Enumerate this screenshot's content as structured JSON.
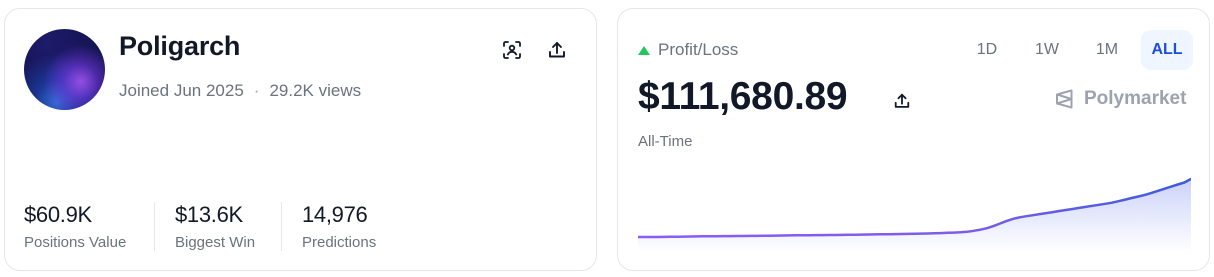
{
  "profile": {
    "username": "Poligarch",
    "joined": "Joined Jun 2025",
    "separator": "·",
    "views": "29.2K views",
    "stats": [
      {
        "value": "$60.9K",
        "label": "Positions Value"
      },
      {
        "value": "$13.6K",
        "label": "Biggest Win"
      },
      {
        "value": "14,976",
        "label": "Predictions"
      }
    ],
    "icons": {
      "scan": "scan-qr-icon",
      "share": "share-upload-icon"
    }
  },
  "pnl": {
    "label": "Profit/Loss",
    "value": "$111,680.89",
    "period": "All-Time",
    "brand": "Polymarket",
    "tabs": [
      {
        "label": "1D",
        "active": false
      },
      {
        "label": "1W",
        "active": false
      },
      {
        "label": "1M",
        "active": false
      },
      {
        "label": "ALL",
        "active": true
      }
    ],
    "colors": {
      "positive": "#22c55e",
      "line_start": "#8b5cf6",
      "line_end": "#3b5bdb"
    }
  },
  "chart_data": {
    "type": "area",
    "title": "",
    "xlabel": "",
    "ylabel": "",
    "grid": false,
    "y": [
      0,
      0,
      0,
      0,
      200,
      400,
      600,
      800,
      1000,
      1200,
      1400,
      1500,
      1600,
      1700,
      1800,
      1900,
      2000,
      2100,
      2200,
      2300,
      2400,
      2600,
      2800,
      3000,
      3200,
      3400,
      3500,
      3600,
      3700,
      3800,
      3900,
      4000,
      4200,
      4400,
      4600,
      4800,
      5000,
      5200,
      5400,
      5600,
      5800,
      6000,
      6200,
      6500,
      6800,
      7100,
      7500,
      8000,
      8500,
      9000,
      10000,
      12000,
      14000,
      17000,
      21000,
      26000,
      31000,
      35000,
      38000,
      40000,
      42000,
      44000,
      46000,
      48000,
      50000,
      52000,
      54000,
      56000,
      58000,
      60000,
      62000,
      64000,
      66000,
      69000,
      72000,
      75000,
      78000,
      81000,
      85000,
      89000,
      93000,
      97000,
      101000,
      105000,
      111680.89
    ]
  }
}
